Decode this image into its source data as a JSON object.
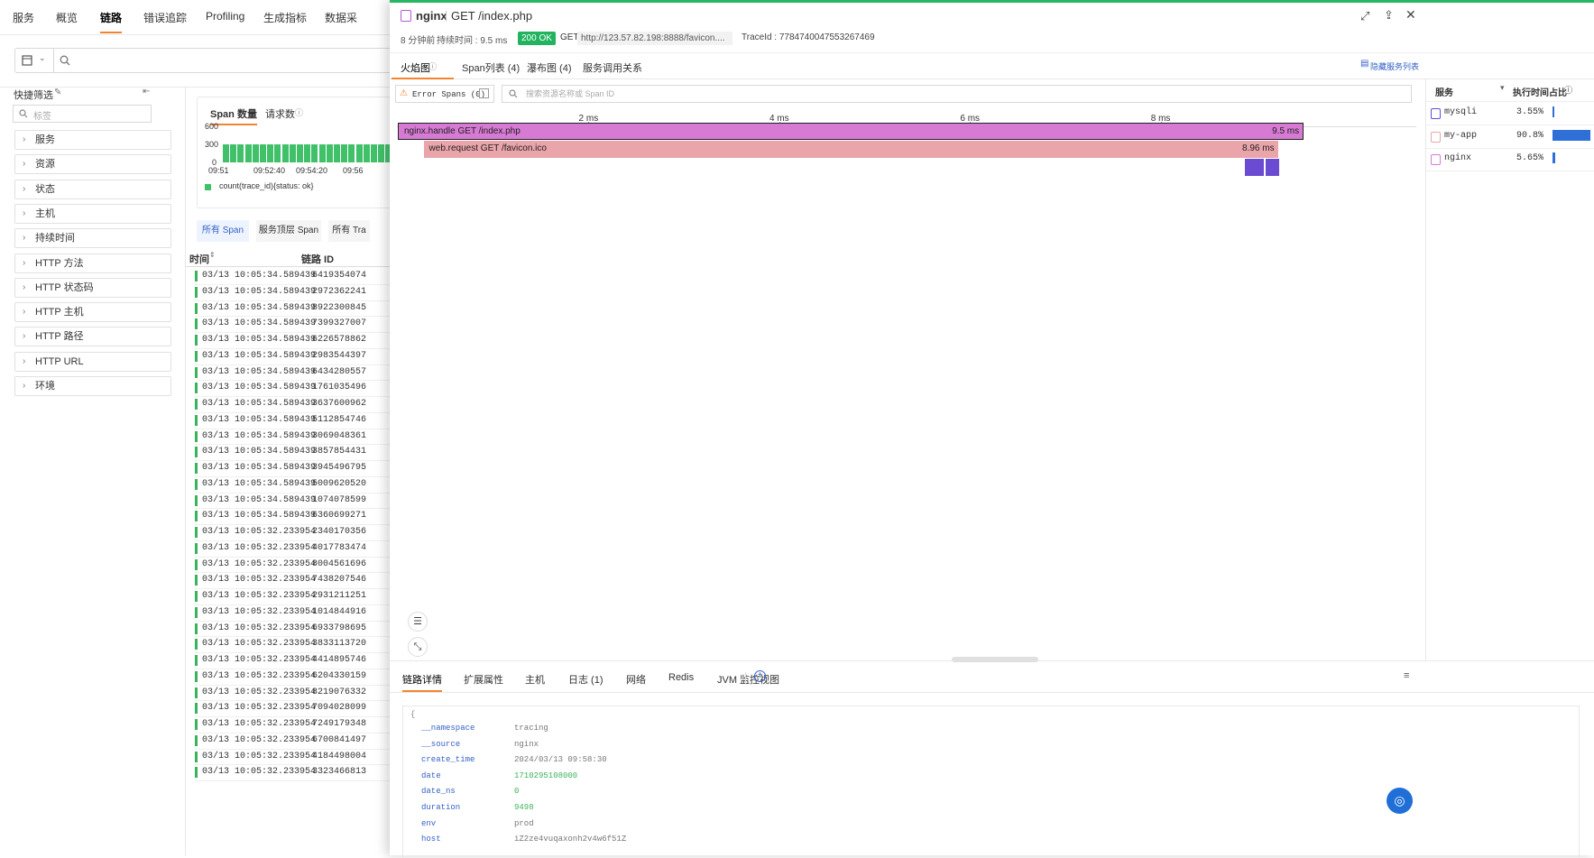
{
  "topnav": {
    "tabs": [
      {
        "label": "服务",
        "active": false
      },
      {
        "label": "概览",
        "active": false
      },
      {
        "label": "链路",
        "active": true
      },
      {
        "label": "错误追踪",
        "active": false
      },
      {
        "label": "Profiling",
        "active": false
      },
      {
        "label": "生成指标",
        "active": false
      },
      {
        "label": "数据采",
        "active": false
      }
    ]
  },
  "sidebar": {
    "title": "快捷筛选",
    "search_placeholder": "标签",
    "groups": [
      "服务",
      "资源",
      "状态",
      "主机",
      "持续时间",
      "HTTP 方法",
      "HTTP 状态码",
      "HTTP 主机",
      "HTTP 路径",
      "HTTP URL",
      "环境"
    ]
  },
  "list": {
    "chart_tabs": [
      "Span 数量",
      "请求数"
    ],
    "chart_data": {
      "type": "bar",
      "y_ticks": [
        "600",
        "300",
        "0"
      ],
      "x_ticks": [
        "09:51",
        "09:52:40",
        "09:54:20",
        "09:56"
      ],
      "legend": "count(trace_id){status: ok}",
      "color": "#41c06a"
    },
    "span_tabs": [
      "所有 Span",
      "服务顶层 Span",
      "所有 Tra"
    ],
    "columns": {
      "time": "时间",
      "trace_id": "链路 ID"
    },
    "rows": [
      {
        "time": "03/13 10:05:34.589439",
        "id": "6419354074"
      },
      {
        "time": "03/13 10:05:34.589439",
        "id": "2972362241"
      },
      {
        "time": "03/13 10:05:34.589439",
        "id": "8922300845"
      },
      {
        "time": "03/13 10:05:34.589439",
        "id": "7399327007"
      },
      {
        "time": "03/13 10:05:34.589439",
        "id": "6226578862"
      },
      {
        "time": "03/13 10:05:34.589439",
        "id": "2983544397"
      },
      {
        "time": "03/13 10:05:34.589439",
        "id": "6434280557"
      },
      {
        "time": "03/13 10:05:34.589439",
        "id": "1761035496"
      },
      {
        "time": "03/13 10:05:34.589439",
        "id": "3637600962"
      },
      {
        "time": "03/13 10:05:34.589439",
        "id": "5112854746"
      },
      {
        "time": "03/13 10:05:34.589439",
        "id": "3069048361"
      },
      {
        "time": "03/13 10:05:34.589439",
        "id": "3857854431"
      },
      {
        "time": "03/13 10:05:34.589439",
        "id": "3945496795"
      },
      {
        "time": "03/13 10:05:34.589439",
        "id": "5009620520"
      },
      {
        "time": "03/13 10:05:34.589439",
        "id": "1074078599"
      },
      {
        "time": "03/13 10:05:34.589439",
        "id": "6360699271"
      },
      {
        "time": "03/13 10:05:32.233954",
        "id": "2340170356"
      },
      {
        "time": "03/13 10:05:32.233954",
        "id": "4017783474"
      },
      {
        "time": "03/13 10:05:32.233954",
        "id": "8004561696"
      },
      {
        "time": "03/13 10:05:32.233954",
        "id": "7438207546"
      },
      {
        "time": "03/13 10:05:32.233954",
        "id": "2931211251"
      },
      {
        "time": "03/13 10:05:32.233954",
        "id": "1014844916"
      },
      {
        "time": "03/13 10:05:32.233954",
        "id": "6933798695"
      },
      {
        "time": "03/13 10:05:32.233954",
        "id": "3833113720"
      },
      {
        "time": "03/13 10:05:32.233954",
        "id": "4414895746"
      },
      {
        "time": "03/13 10:05:32.233954",
        "id": "6204330159"
      },
      {
        "time": "03/13 10:05:32.233954",
        "id": "8219076332"
      },
      {
        "time": "03/13 10:05:32.233954",
        "id": "7094028099"
      },
      {
        "time": "03/13 10:05:32.233954",
        "id": "7249179348"
      },
      {
        "time": "03/13 10:05:32.233954",
        "id": "6700841497"
      },
      {
        "time": "03/13 10:05:32.233954",
        "id": "4184498004"
      },
      {
        "time": "03/13 10:05:32.233954",
        "id": "3323466813"
      }
    ]
  },
  "drawer": {
    "service": "nginx",
    "resource": "GET /index.php",
    "ago": "8 分钟前",
    "duration_label": "持续时间 : 9.5 ms",
    "status": "200 OK",
    "method": "GET",
    "url": "http://123.57.82.198:8888/favicon....",
    "trace_id": "TraceId : 7784740047553267469",
    "tabs": [
      {
        "label": "火焰图",
        "active": true
      },
      {
        "label": "Span列表 (4)",
        "active": false
      },
      {
        "label": "瀑布图 (4)",
        "active": false
      },
      {
        "label": "服务调用关系",
        "active": false
      }
    ],
    "hide_service_list": "隐藏服务列表",
    "error_spans_label": "Error Spans (0)",
    "span_search_placeholder": "搜索资源名称或 Span ID",
    "axis_ticks": [
      "2 ms",
      "4 ms",
      "6 ms",
      "8 ms"
    ],
    "spans": [
      {
        "name": "nginx.handle GET /index.php",
        "duration": "9.5 ms",
        "start_ms": 0,
        "end_ms": 9.5,
        "depth": 0,
        "color": "#d77ad4"
      },
      {
        "name": "web.request GET /favicon.ico",
        "duration": "8.96 ms",
        "start_ms": 0.27,
        "end_ms": 9.23,
        "depth": 1,
        "color": "#eaa5aa"
      },
      {
        "name": "",
        "duration": "",
        "start_ms": 8.88,
        "end_ms": 9.08,
        "depth": 2,
        "color": "#6b4bd1"
      },
      {
        "name": "",
        "duration": "",
        "start_ms": 9.1,
        "end_ms": 9.24,
        "depth": 2,
        "color": "#6b4bd1"
      }
    ],
    "services_header": {
      "name": "服务",
      "pct": "执行时间占比"
    },
    "services": [
      {
        "name": "mysqli",
        "pct": "3.55%",
        "value": 3.55,
        "color": "#6b4bd1"
      },
      {
        "name": "my-app",
        "pct": "90.8%",
        "value": 90.8,
        "color": "#eaa5aa"
      },
      {
        "name": "nginx",
        "pct": "5.65%",
        "value": 5.65,
        "color": "#d77ad4"
      }
    ],
    "bottom_tabs": [
      {
        "label": "链路详情",
        "active": true
      },
      {
        "label": "扩展属性",
        "active": false
      },
      {
        "label": "主机",
        "active": false
      },
      {
        "label": "日志 (1)",
        "active": false
      },
      {
        "label": "网络",
        "active": false
      },
      {
        "label": "Redis",
        "active": false
      },
      {
        "label": "JVM 监控视图",
        "active": false
      }
    ],
    "details": [
      {
        "k": "__namespace",
        "v": "tracing",
        "num": false
      },
      {
        "k": "__source",
        "v": "nginx",
        "num": false
      },
      {
        "k": "create_time",
        "v": "2024/03/13 09:58:30",
        "num": false
      },
      {
        "k": "date",
        "v": "1710295108000",
        "num": true
      },
      {
        "k": "date_ns",
        "v": "0",
        "num": true
      },
      {
        "k": "duration",
        "v": "9498",
        "num": true
      },
      {
        "k": "env",
        "v": "prod",
        "num": false
      },
      {
        "k": "host",
        "v": "iZ2ze4vuqaxonh2v4w6f51Z",
        "num": false
      }
    ],
    "json_open": "{"
  }
}
